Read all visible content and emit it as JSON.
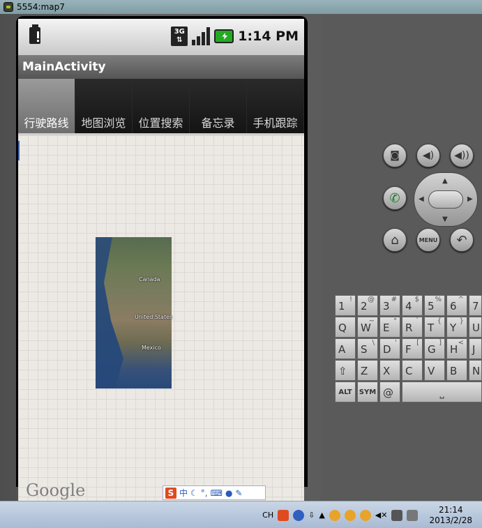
{
  "window": {
    "title": "5554:map7"
  },
  "status_bar": {
    "network": "3G",
    "time": "1:14 PM"
  },
  "app": {
    "title": "MainActivity"
  },
  "tabs": [
    {
      "label": "行驶路线",
      "selected": true
    },
    {
      "label": "地图浏览",
      "selected": false
    },
    {
      "label": "位置搜索",
      "selected": false
    },
    {
      "label": "备忘录",
      "selected": false
    },
    {
      "label": "手机跟踪",
      "selected": false
    }
  ],
  "map": {
    "labels": {
      "canada": "Canada",
      "united_states": "United States",
      "mexico": "Mexico"
    },
    "logo": "Google"
  },
  "ime": {
    "mode": "中"
  },
  "emulator": {
    "menu_label": "MENU",
    "keys": {
      "row1": [
        [
          "1",
          "!"
        ],
        [
          "2",
          "@"
        ],
        [
          "3",
          "#"
        ],
        [
          "4",
          "$"
        ],
        [
          "5",
          "%"
        ],
        [
          "6",
          "^"
        ],
        [
          "7",
          "&"
        ]
      ],
      "row2": [
        [
          "Q",
          ""
        ],
        [
          "W",
          "~"
        ],
        [
          "E",
          "\""
        ],
        [
          "R",
          "`"
        ],
        [
          "T",
          "{"
        ],
        [
          "Y",
          "}"
        ],
        [
          "U",
          ""
        ]
      ],
      "row3": [
        [
          "A",
          ""
        ],
        [
          "S",
          "\\"
        ],
        [
          "D",
          "'"
        ],
        [
          "F",
          "["
        ],
        [
          "G",
          "]"
        ],
        [
          "H",
          "<"
        ],
        [
          "J",
          ">"
        ]
      ],
      "row4": [
        [
          "Z",
          ""
        ],
        [
          "X",
          ""
        ],
        [
          "C",
          ""
        ],
        [
          "V",
          ""
        ],
        [
          "B",
          ""
        ],
        [
          "N",
          ""
        ]
      ],
      "row5": {
        "alt": "ALT",
        "sym": "SYM",
        "at": "@"
      }
    }
  },
  "taskbar": {
    "lang": "CH",
    "time": "21:14",
    "date": "2013/2/28"
  }
}
